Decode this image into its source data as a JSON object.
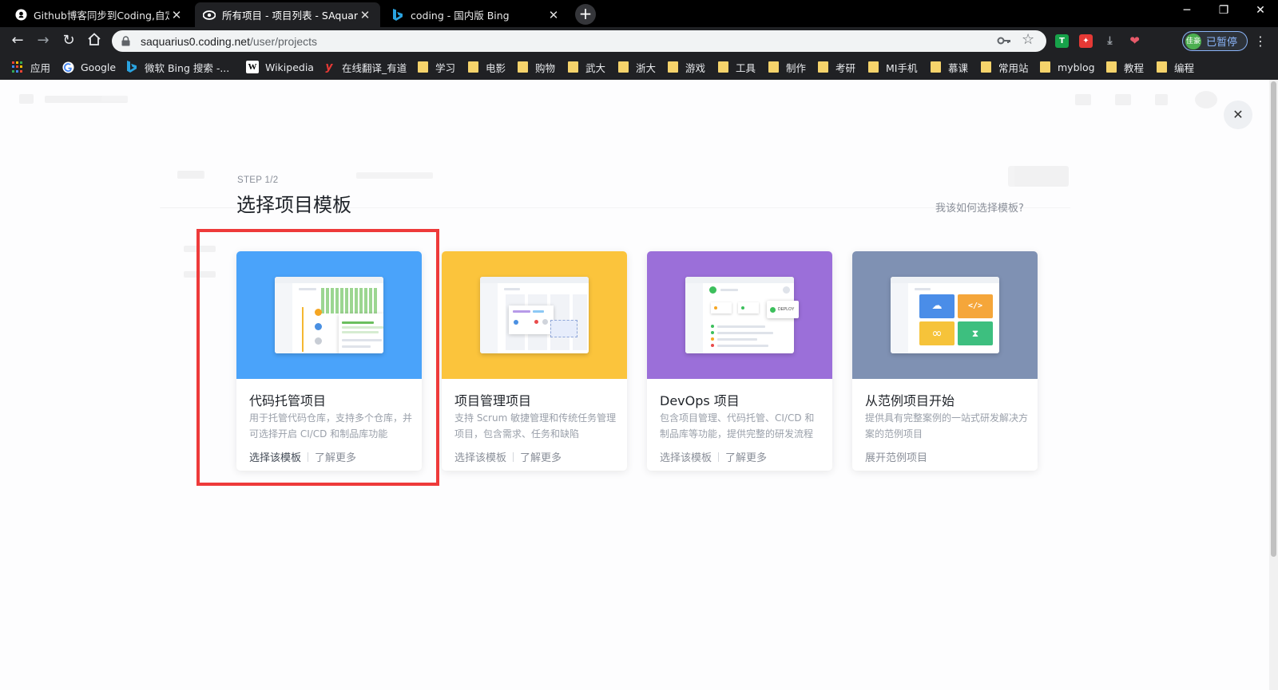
{
  "browser": {
    "tabs": [
      {
        "title": "Github博客同步到Coding,自定义"
      },
      {
        "title": "所有项目 - 项目列表 - SAquarius"
      },
      {
        "title": "coding - 国内版 Bing"
      }
    ],
    "url_host": "saquarius0.coding.net",
    "url_path": "/user/projects",
    "profile_avatar": "佳豪",
    "profile_label": "已暂停",
    "bookmarks": [
      {
        "label": "应用",
        "icon": "apps-grid-icon"
      },
      {
        "label": "Google",
        "icon": "google-icon"
      },
      {
        "label": "微软 Bing 搜索 -...",
        "icon": "bing-icon"
      },
      {
        "label": "Wikipedia",
        "icon": "wikipedia-icon"
      },
      {
        "label": "在线翻译_有道",
        "icon": "youdao-icon"
      },
      {
        "label": "学习",
        "icon": "folder-icon"
      },
      {
        "label": "电影",
        "icon": "folder-icon"
      },
      {
        "label": "购物",
        "icon": "folder-icon"
      },
      {
        "label": "武大",
        "icon": "folder-icon"
      },
      {
        "label": "浙大",
        "icon": "folder-icon"
      },
      {
        "label": "游戏",
        "icon": "folder-icon"
      },
      {
        "label": "工具",
        "icon": "folder-icon"
      },
      {
        "label": "制作",
        "icon": "folder-icon"
      },
      {
        "label": "考研",
        "icon": "folder-icon"
      },
      {
        "label": "MI手机",
        "icon": "folder-icon"
      },
      {
        "label": "慕课",
        "icon": "folder-icon"
      },
      {
        "label": "常用站",
        "icon": "folder-icon"
      },
      {
        "label": "myblog",
        "icon": "folder-icon"
      },
      {
        "label": "教程",
        "icon": "folder-icon"
      },
      {
        "label": "编程",
        "icon": "folder-icon"
      }
    ]
  },
  "dialog": {
    "step": "STEP 1/2",
    "title": "选择项目模板",
    "help_link": "我该如何选择模板?",
    "close_icon": "close-icon",
    "cards": [
      {
        "title": "代码托管项目",
        "desc": "用于托管代码仓库，支持多个仓库，并可选择开启 CI/CD 和制品库功能",
        "primary": "选择该模板",
        "more": "了解更多",
        "color": "#4aa3fa"
      },
      {
        "title": "项目管理项目",
        "desc": "支持 Scrum 敏捷管理和传统任务管理项目，包含需求、任务和缺陷",
        "primary": "选择该模板",
        "more": "了解更多",
        "color": "#fbc43c"
      },
      {
        "title": "DevOps 项目",
        "desc": "包含项目管理、代码托管、CI/CD 和制品库等功能，提供完整的研发流程",
        "primary": "选择该模板",
        "more": "了解更多",
        "color": "#9b6fd9",
        "deploy_label": "DEPLOY"
      },
      {
        "title": "从范例项目开始",
        "desc": "提供具有完整案例的一站式研发解决方案的范例项目",
        "primary": "展开范例项目",
        "color": "#7f91b3"
      }
    ]
  },
  "colors": {
    "highlight": "#ee3a3a",
    "chrome_dark": "#202124"
  }
}
